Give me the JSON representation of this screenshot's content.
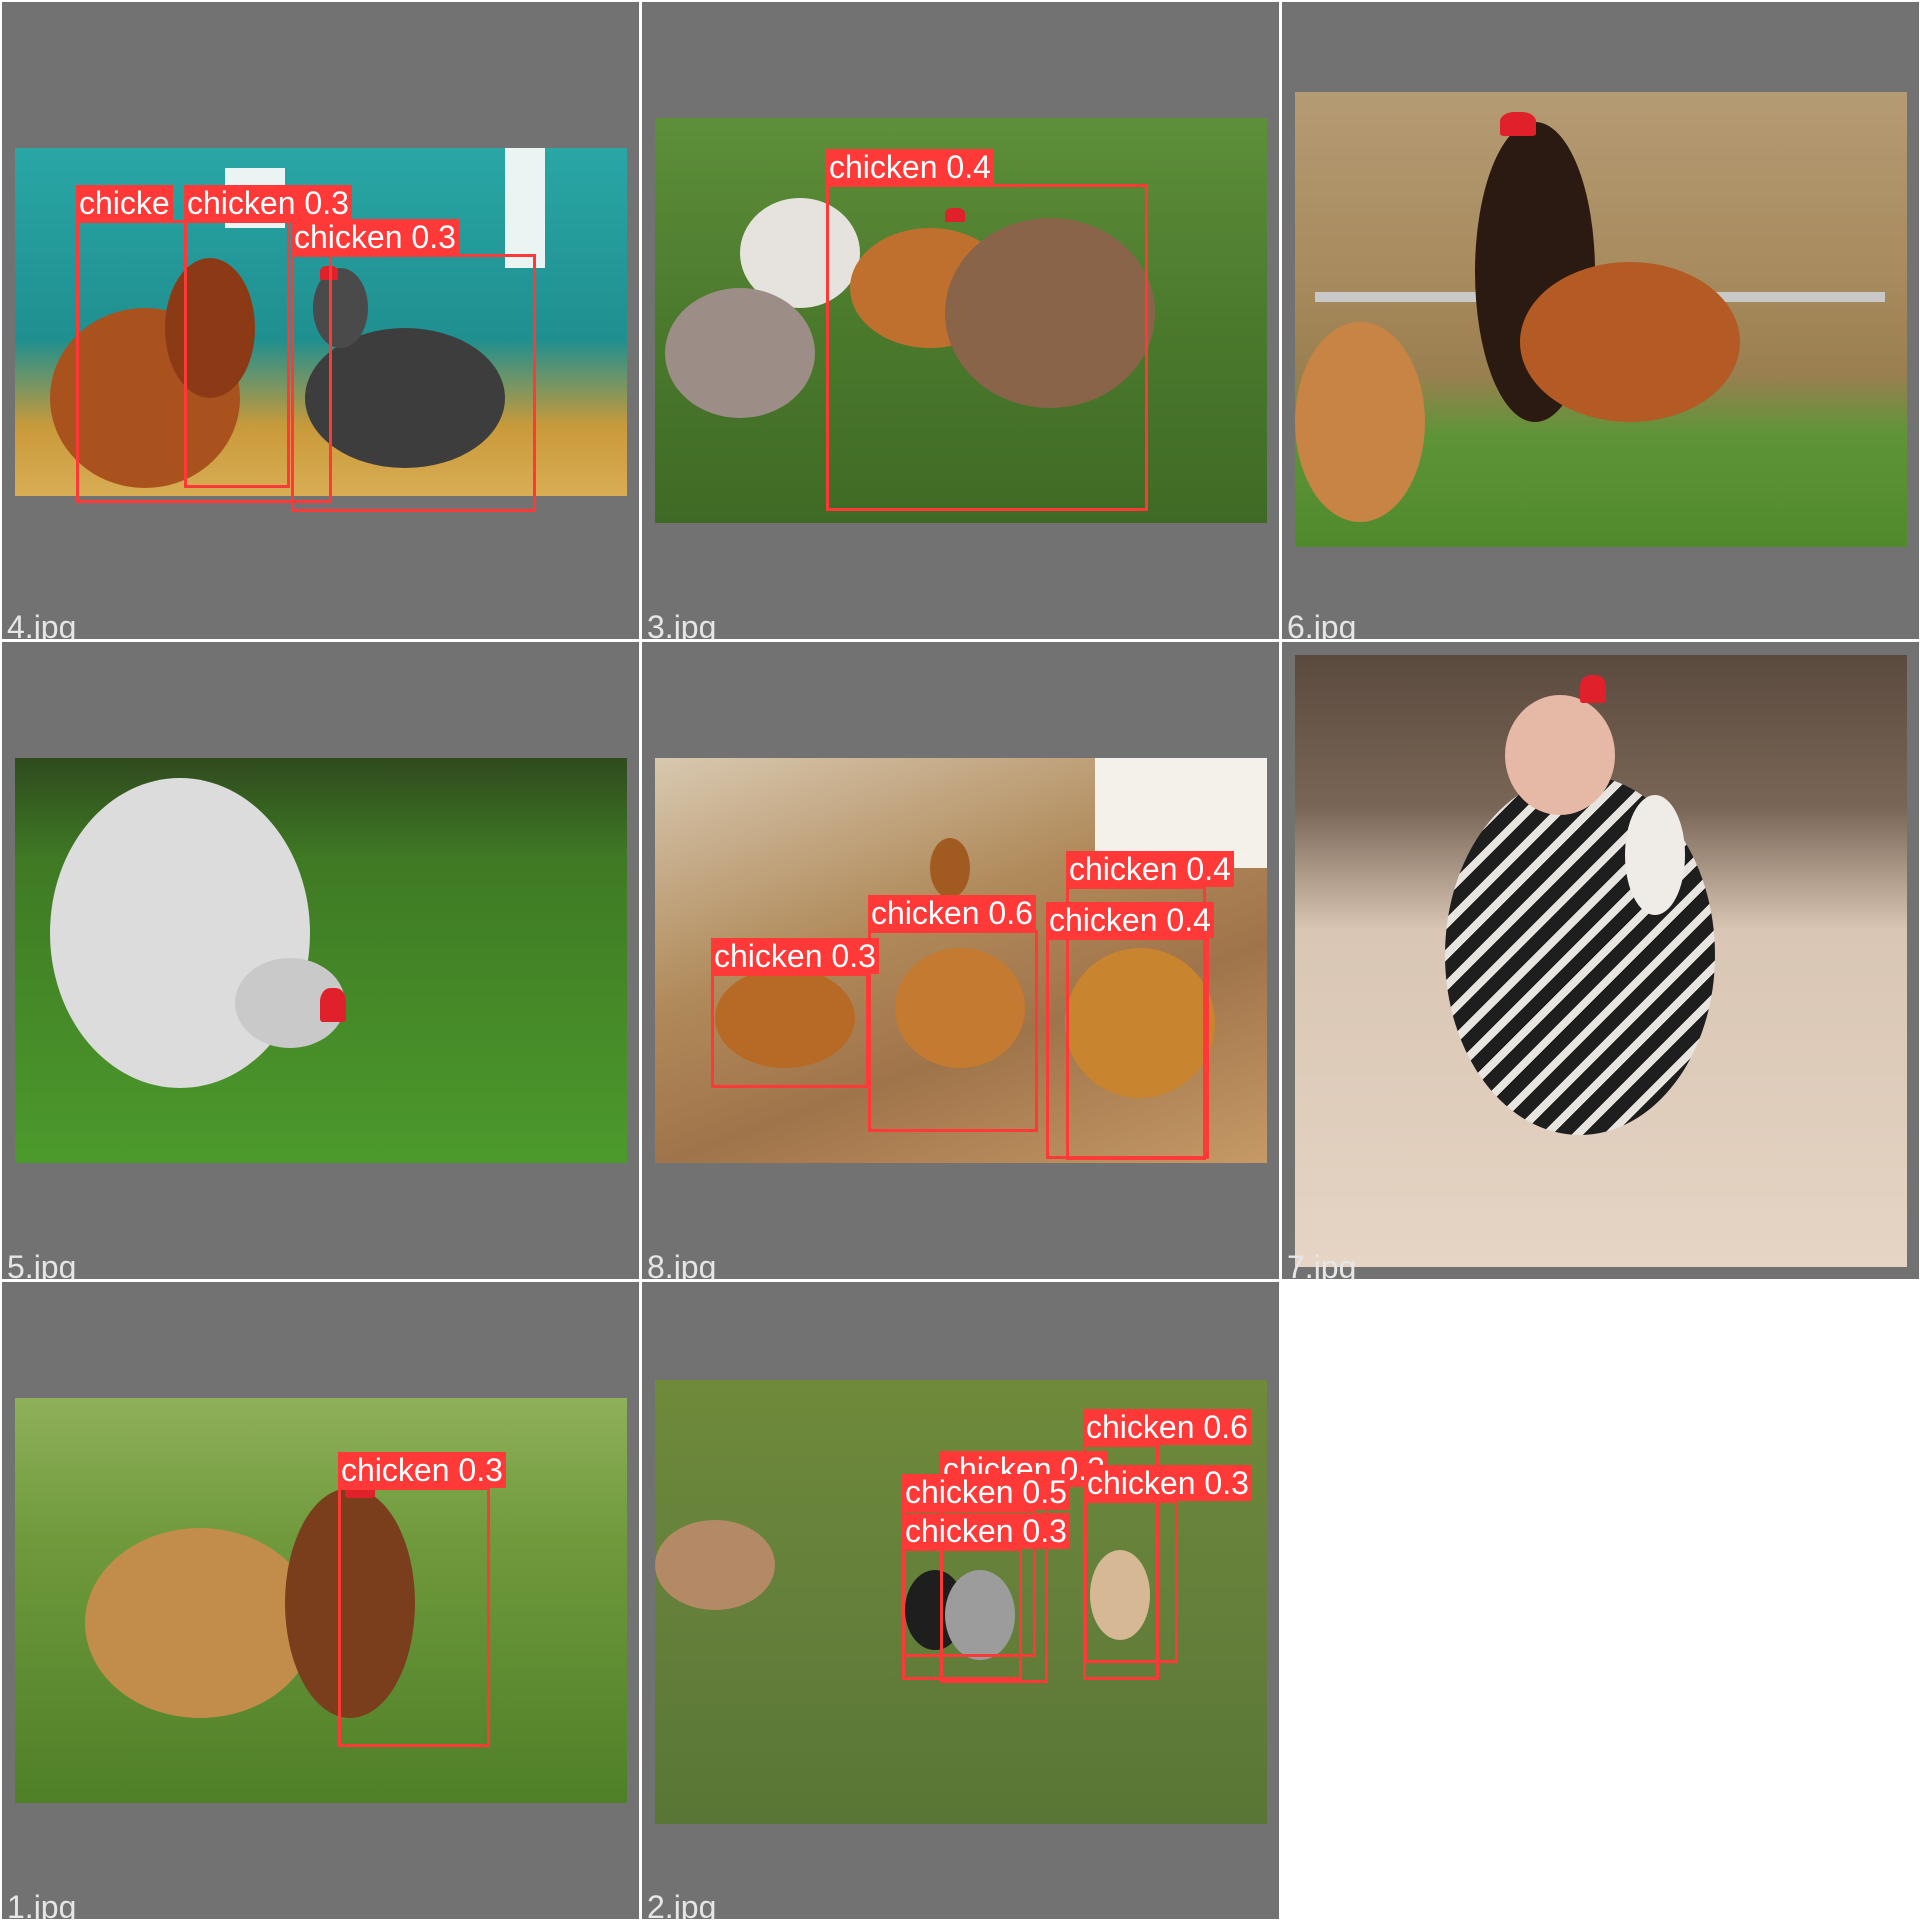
{
  "grid": {
    "background": "#ffffff",
    "tile_color": "#727272",
    "box_color": "#ff3838",
    "label_text_color": "#ffffff",
    "filename_color": "#e6e6e6"
  },
  "tiles": [
    {
      "file": "4.jpg",
      "detections": [
        {
          "label": "chicke"
        },
        {
          "label": "chicken 0.3"
        },
        {
          "label": "chicken 0.3"
        }
      ]
    },
    {
      "file": "3.jpg",
      "detections": [
        {
          "label": "chicken 0.4"
        }
      ]
    },
    {
      "file": "6.jpg",
      "detections": []
    },
    {
      "file": "5.jpg",
      "detections": []
    },
    {
      "file": "8.jpg",
      "detections": [
        {
          "label": "chicken 0.4"
        },
        {
          "label": "chicken 0.6"
        },
        {
          "label": "chicken 0.4"
        },
        {
          "label": "chicken 0.3"
        }
      ]
    },
    {
      "file": "7.jpg",
      "detections": []
    },
    {
      "file": "1.jpg",
      "detections": [
        {
          "label": "chicken 0.3"
        }
      ]
    },
    {
      "file": "2.jpg",
      "detections": [
        {
          "label": "chicken 0.6"
        },
        {
          "label": "chicken 0.3"
        },
        {
          "label": "chicken 0.5"
        },
        {
          "label": "chicken 0.3"
        },
        {
          "label": "chicken 0.3"
        }
      ]
    }
  ]
}
